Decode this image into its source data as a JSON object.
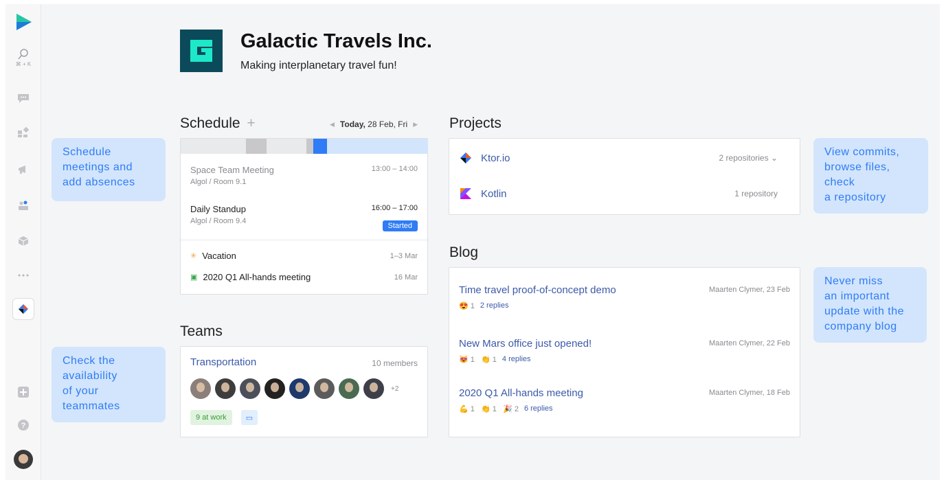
{
  "sidebar": {
    "search_shortcut": "⌘ + K"
  },
  "org": {
    "name": "Galactic Travels Inc.",
    "tagline": "Making interplanetary travel fun!"
  },
  "schedule": {
    "title": "Schedule",
    "add": "+",
    "date_prefix": "Today,",
    "date": "28 Feb, Fri",
    "events": [
      {
        "title": "Space Team Meeting",
        "location": "Algol / Room 9.1",
        "time": "13:00 – 14:00"
      },
      {
        "title": "Daily Standup",
        "location": "Algol / Room 9.4",
        "time": "16:00 – 17:00",
        "status": "Started"
      }
    ],
    "absences": [
      {
        "title": "Vacation",
        "date": "1–3 Mar"
      },
      {
        "title": "2020 Q1 All-hands meeting",
        "date": "16 Mar"
      }
    ]
  },
  "teams": {
    "title": "Teams",
    "team_name": "Transportation",
    "members": "10 members",
    "more": "+2",
    "at_work": "9 at work"
  },
  "projects": {
    "title": "Projects",
    "items": [
      {
        "name": "Ktor.io",
        "meta": "2 repositories"
      },
      {
        "name": "Kotlin",
        "meta": "1 repository"
      }
    ]
  },
  "blog": {
    "title": "Blog",
    "posts": [
      {
        "title": "Time travel proof-of-concept demo",
        "author": "Maarten Clymer, 23 Feb",
        "reactions": "😍 1",
        "replies": "2 replies"
      },
      {
        "title": "New Mars office just opened!",
        "author": "Maarten Clymer, 22 Feb",
        "reactions": "😻 1   👏 1",
        "replies": "4 replies"
      },
      {
        "title": "2020 Q1 All-hands meeting",
        "author": "Maarten Clymer, 18 Feb",
        "reactions": "💪 1   👏 1   🎉 2",
        "replies": "6 replies"
      }
    ]
  },
  "tips": {
    "schedule": "Schedule\nmeetings and\nadd absences",
    "teams": "Check the\navailability\nof your\nteammates",
    "projects": "View commits,\nbrowse files,\ncheck\na repository",
    "blog": "Never miss\nan important\nupdate with the\ncompany blog"
  },
  "colors": {
    "accent": "#2f7cf6",
    "tip_bg": "#d2e5fc",
    "link": "#3b5aa8"
  }
}
